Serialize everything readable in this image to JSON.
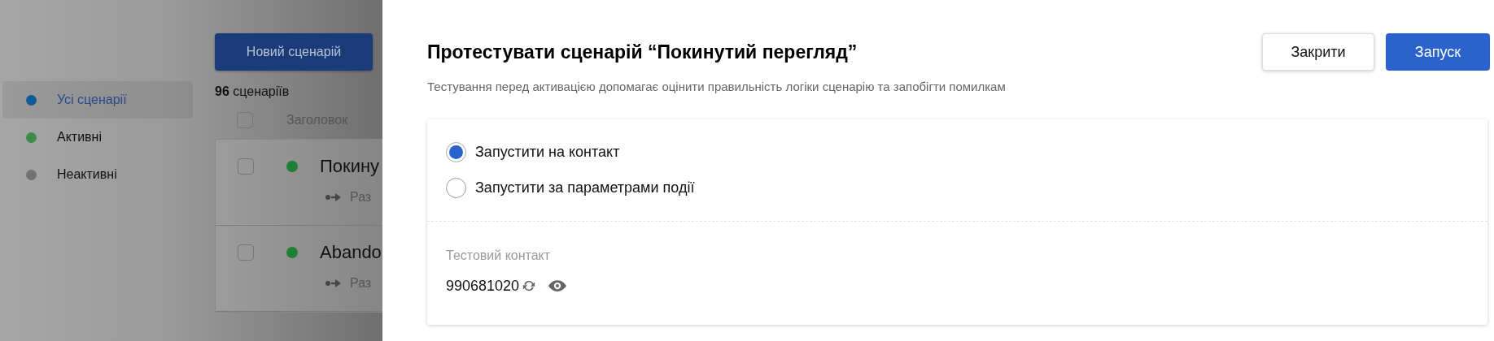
{
  "sidebar": {
    "items": [
      {
        "label": "Усі сценарії",
        "color": "#0e5c96",
        "selected": true
      },
      {
        "label": "Активні",
        "color": "#3d8a4c",
        "selected": false
      },
      {
        "label": "Неактивні",
        "color": "#717171",
        "selected": false
      }
    ]
  },
  "list": {
    "new_button": "Новий сценарій",
    "count": "**96** сценаріїв",
    "header": {
      "checked": false,
      "title": "Заголовок"
    },
    "rows": [
      {
        "checked": false,
        "color": "#1f7f35",
        "title": "Покину",
        "subtitle": "Раз"
      },
      {
        "checked": false,
        "color": "#1f7f35",
        "title": "Abando",
        "subtitle": "Раз"
      }
    ]
  },
  "dialog": {
    "title": "Протестувати сценарій “Покинутий перегляд”",
    "subtitle": "Тестування перед активацією допомагає оцінити правильність логіки сценарію та запобігти помилкам",
    "buttons": [
      {
        "label": "Закрити",
        "kind": "secondary"
      },
      {
        "label": "Запуск",
        "kind": "primary"
      }
    ],
    "options": [
      {
        "label": "Запустити на контакт",
        "selected": true
      },
      {
        "label": "Запустити за параметрами події",
        "selected": false
      }
    ],
    "contact": {
      "label": "Тестовий контакт",
      "value": "990681020"
    }
  }
}
